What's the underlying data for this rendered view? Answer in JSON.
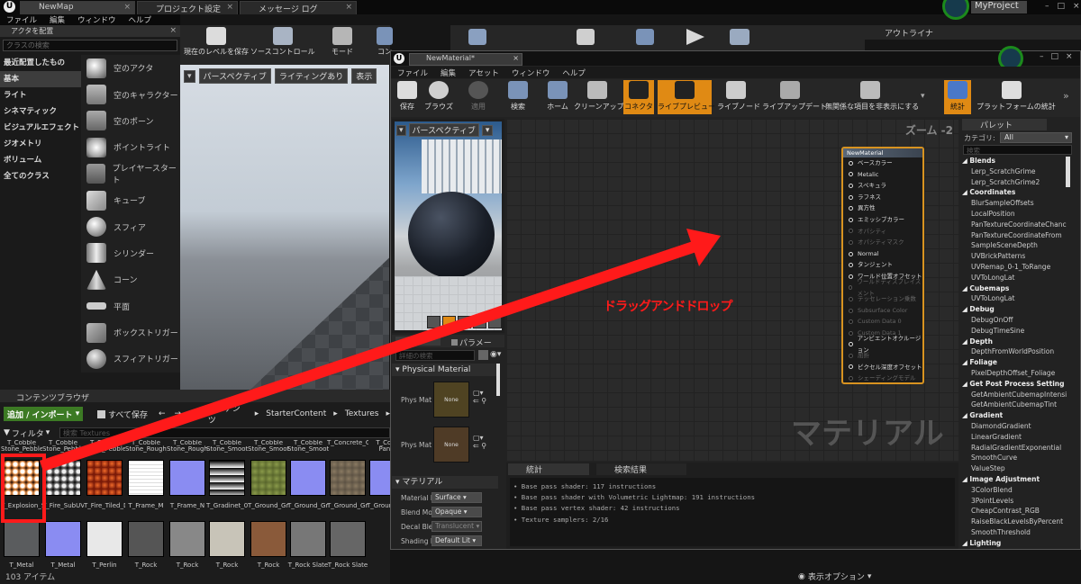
{
  "titlebar": {
    "tabs": [
      "NewMap",
      "プロジェクト設定",
      "メッセージ ログ"
    ],
    "project": "MyProject"
  },
  "menubar": [
    "ファイル",
    "編集",
    "ウィンドウ",
    "ヘルプ"
  ],
  "place_actors": {
    "title": "アクタを配置",
    "search_placeholder": "クラスの検索",
    "categories": [
      "最近配置したもの",
      "基本",
      "ライト",
      "シネマティック",
      "ビジュアルエフェクト",
      "ジオメトリ",
      "ボリューム",
      "全てのクラス"
    ],
    "actors": [
      "空のアクタ",
      "空のキャラクター",
      "空のポーン",
      "ポイントライト",
      "プレイヤースタート",
      "キューブ",
      "スフィア",
      "シリンダー",
      "コーン",
      "平面",
      "ボックストリガー",
      "スフィアトリガー"
    ]
  },
  "main_toolbar": {
    "items": [
      "現在のレベルを保存",
      "ソースコントロール",
      "モード",
      "コン"
    ]
  },
  "viewport": {
    "perspective": "パースペクティブ",
    "lighting": "ライティングあり",
    "show": "表示"
  },
  "outliner": {
    "title": "アウトライナ"
  },
  "content_browser": {
    "title": "コンテンツブラウザ",
    "add_import": "追加 / インポート",
    "save_all": "すべて保存",
    "path": [
      "コンテンツ",
      "StarterContent",
      "Textures"
    ],
    "filter": "フィルタ",
    "search_placeholder": "検索 Textures",
    "top_row_labels": [
      "T_Cobble Stone_Pebble_",
      "T_Cobble Stone_Pebble_M",
      "T_Cobble Stone_Pebble_N",
      "T_Cobble Stone_Rough_D",
      "T_Cobble Stone_Rough_N",
      "T_Cobble Stone_Smooth_D",
      "T_Cobble Stone_Smooth_M",
      "T_Cobble Stone_Smooth_N",
      "T_Concrete_Grime_D",
      "T_Conc Panel"
    ],
    "assets": [
      "T_Explosion_SubUV",
      "T_Fire_SubUV",
      "T_Fire_Tiled_D",
      "T_Frame_M",
      "T_Frame_N",
      "T_Gradinet_01",
      "T_Ground_Grass_D",
      "T_Ground_Grass_N",
      "T_Ground_Gravel_D",
      "T_Ground_Gravel_N"
    ],
    "bottom_labels": [
      "T_Metal Steel",
      "T_Metal Steel",
      "T_Perlin",
      "T_Rock",
      "T_Rock",
      "T_Rock",
      "T_Rock",
      "T_Rock Slate",
      "T_Rock Slate"
    ],
    "item_count": "103 アイテム"
  },
  "material_editor": {
    "tab": "NewMaterial*",
    "menu": [
      "ファイル",
      "編集",
      "アセット",
      "ウィンドウ",
      "ヘルプ"
    ],
    "toolbar": [
      "保存",
      "ブラウズ",
      "適用",
      "検索",
      "ホーム",
      "クリーンアップ",
      "コネクタ",
      "ライブプレビュー",
      "ライブノード",
      "ライブアップデート",
      "無関係な項目を非表示にする",
      "統計",
      "プラットフォームの統計"
    ],
    "preview": {
      "perspective": "パースペクティブ"
    },
    "details": {
      "tab_params": "パラメー",
      "search_placeholder": "詳細の検索",
      "section_physical": "Physical Material",
      "phys_mat_label": "Phys Mat",
      "none": "None",
      "section_material": "マテリアル",
      "rows": [
        {
          "label": "Material D",
          "value": "Surface"
        },
        {
          "label": "Blend Mo",
          "value": "Opaque"
        },
        {
          "label": "Decal Ble",
          "value": "Translucent"
        },
        {
          "label": "Shading I",
          "value": "Default Lit"
        }
      ]
    },
    "graph": {
      "zoom": "ズーム -2",
      "watermark": "マテリアル",
      "annotation": "ドラッグアンドドロップ",
      "node_title": "NewMaterial",
      "pins": [
        {
          "label": "ベースカラー",
          "on": true
        },
        {
          "label": "Metalic",
          "on": true
        },
        {
          "label": "スペキュラ",
          "on": true
        },
        {
          "label": "ラフネス",
          "on": true
        },
        {
          "label": "異方性",
          "on": true
        },
        {
          "label": "エミッシブカラー",
          "on": true
        },
        {
          "label": "オパシティ",
          "on": false
        },
        {
          "label": "オパシティマスク",
          "on": false
        },
        {
          "label": "Normal",
          "on": true
        },
        {
          "label": "タンジェント",
          "on": true
        },
        {
          "label": "ワールド位置オフセット",
          "on": true
        },
        {
          "label": "ワールドディスプレイスメント",
          "on": false
        },
        {
          "label": "テッセレーション乗数",
          "on": false
        },
        {
          "label": "Subsurface Color",
          "on": false
        },
        {
          "label": "Custom Data 0",
          "on": false
        },
        {
          "label": "Custom Data 1",
          "on": false
        },
        {
          "label": "アンビエントオクルージョン",
          "on": true
        },
        {
          "label": "屈折",
          "on": false
        },
        {
          "label": "ピクセル深度オフセット",
          "on": true
        },
        {
          "label": "シェーディングモデル",
          "on": false
        }
      ]
    },
    "stats": {
      "tab": "統計",
      "tab2": "検索結果",
      "lines": [
        "Base pass shader: 117 instructions",
        "Base pass shader with Volumetric Lightmap: 191 instructions",
        "Base pass vertex shader: 42 instructions",
        "Texture samplers: 2/16"
      ]
    },
    "palette": {
      "title": "パレット",
      "category_label": "カテゴリ:",
      "category_value": "All",
      "search_placeholder": "検索",
      "items": [
        {
          "t": "Blends",
          "h": true
        },
        {
          "t": "Lerp_ScratchGrime"
        },
        {
          "t": "Lerp_ScratchGrime2"
        },
        {
          "t": "Coordinates",
          "h": true
        },
        {
          "t": "BlurSampleOffsets"
        },
        {
          "t": "LocalPosition"
        },
        {
          "t": "PanTextureCoordinateChanc"
        },
        {
          "t": "PanTextureCoordinateFrom"
        },
        {
          "t": "SampleSceneDepth"
        },
        {
          "t": "UVBrickPatterns"
        },
        {
          "t": "UVRemap_0-1_ToRange"
        },
        {
          "t": "UVToLongLat"
        },
        {
          "t": "Cubemaps",
          "h": true
        },
        {
          "t": "UVToLongLat"
        },
        {
          "t": "Debug",
          "h": true
        },
        {
          "t": "DebugOnOff"
        },
        {
          "t": "DebugTimeSine"
        },
        {
          "t": "Depth",
          "h": true
        },
        {
          "t": "DepthFromWorldPosition"
        },
        {
          "t": "Foliage",
          "h": true
        },
        {
          "t": "PixelDepthOffset_Foliage"
        },
        {
          "t": "Get Post Process Setting",
          "h": true
        },
        {
          "t": "GetAmbientCubemapIntensi"
        },
        {
          "t": "GetAmbientCubemapTint"
        },
        {
          "t": "Gradient",
          "h": true
        },
        {
          "t": "DiamondGradient"
        },
        {
          "t": "LinearGradient"
        },
        {
          "t": "RadialGradientExponential"
        },
        {
          "t": "SmoothCurve"
        },
        {
          "t": "ValueStep"
        },
        {
          "t": "Image Adjustment",
          "h": true
        },
        {
          "t": "3ColorBlend"
        },
        {
          "t": "3PointLevels"
        },
        {
          "t": "CheapContrast_RGB"
        },
        {
          "t": "RaiseBlackLevelsByPercent"
        },
        {
          "t": "SmoothThreshold"
        },
        {
          "t": "Lighting",
          "h": true
        }
      ]
    }
  },
  "bottom_right": {
    "view_options": "表示オプション"
  },
  "colors": {
    "accent_orange": "#e08a14",
    "annotation_red": "#ff1a1a",
    "node_border": "#d89320"
  }
}
